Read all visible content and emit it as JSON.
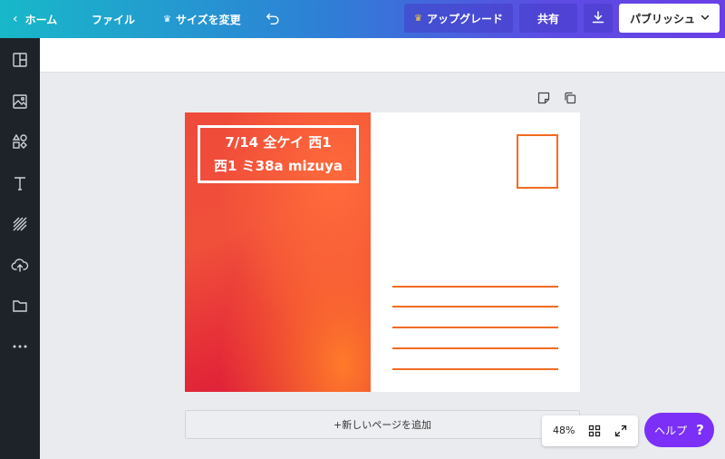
{
  "topbar": {
    "home_label": "ホーム",
    "file_label": "ファイル",
    "resize_label": "サイズを変更",
    "upgrade_label": "アップグレード",
    "share_label": "共有",
    "publish_label": "パブリッシュ",
    "crown_glyph": "♛",
    "back_glyph": "‹"
  },
  "sidebar": {
    "items": [
      "templates-icon",
      "photos-icon",
      "elements-icon",
      "text-icon",
      "background-icon",
      "uploads-icon",
      "folders-icon",
      "more-icon"
    ]
  },
  "card": {
    "title_line1": "7/14 全ケイ 西1",
    "title_line2": "西1 ミ38a mizuya"
  },
  "add_page_label": "+新しいページを追加",
  "zoom": {
    "level": "48%"
  },
  "help": {
    "label": "ヘルプ",
    "glyph": "?"
  },
  "colors": {
    "accent_orange": "#f26b21",
    "help_purple": "#7b2ff7",
    "sidebar_bg": "#1e2329"
  }
}
